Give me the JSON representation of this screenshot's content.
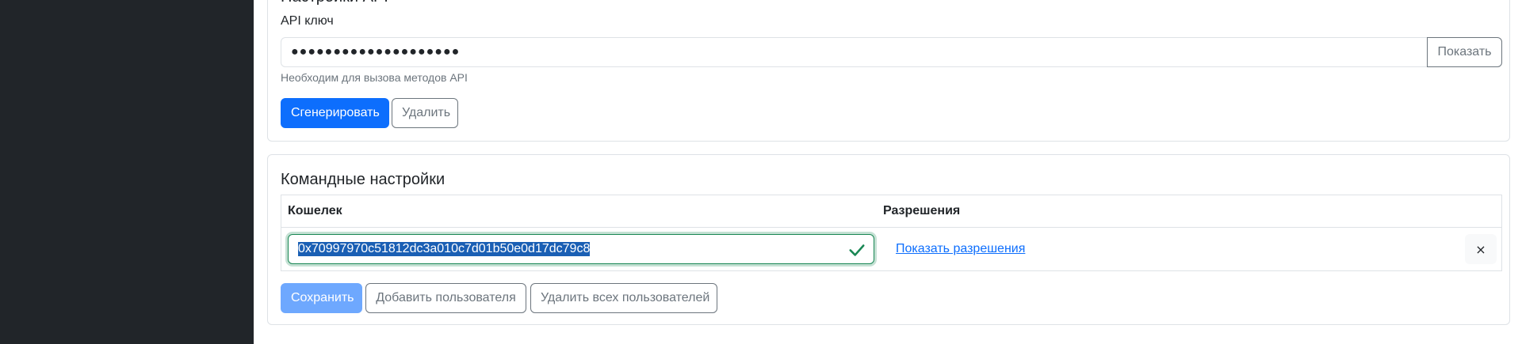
{
  "api_section": {
    "title": "Настройки API",
    "key_label": "API ключ",
    "key_value": "●●●●●●●●●●●●●●●●●●●●",
    "show_button": "Показать",
    "help_text": "Необходим для вызова методов API",
    "generate_button": "Сгенерировать",
    "delete_button": "Удалить"
  },
  "team_section": {
    "title": "Командные настройки",
    "columns": [
      "Кошелек",
      "Разрешения"
    ],
    "rows": [
      {
        "wallet": "0x70997970c51812dc3a010c7d01b50e0d17dc79c8",
        "permissions_link": "Показать разрешения",
        "remove_label": "×"
      }
    ],
    "save_button": "Сохранить",
    "add_user_button": "Добавить пользователя",
    "delete_all_button": "Удалить всех пользователей"
  },
  "colors": {
    "sidebar": "#212529",
    "primary": "#0d6efd",
    "success": "#198754",
    "secondary": "#6c757d"
  },
  "icons": {
    "valid": "check-icon",
    "remove": "close-icon"
  }
}
